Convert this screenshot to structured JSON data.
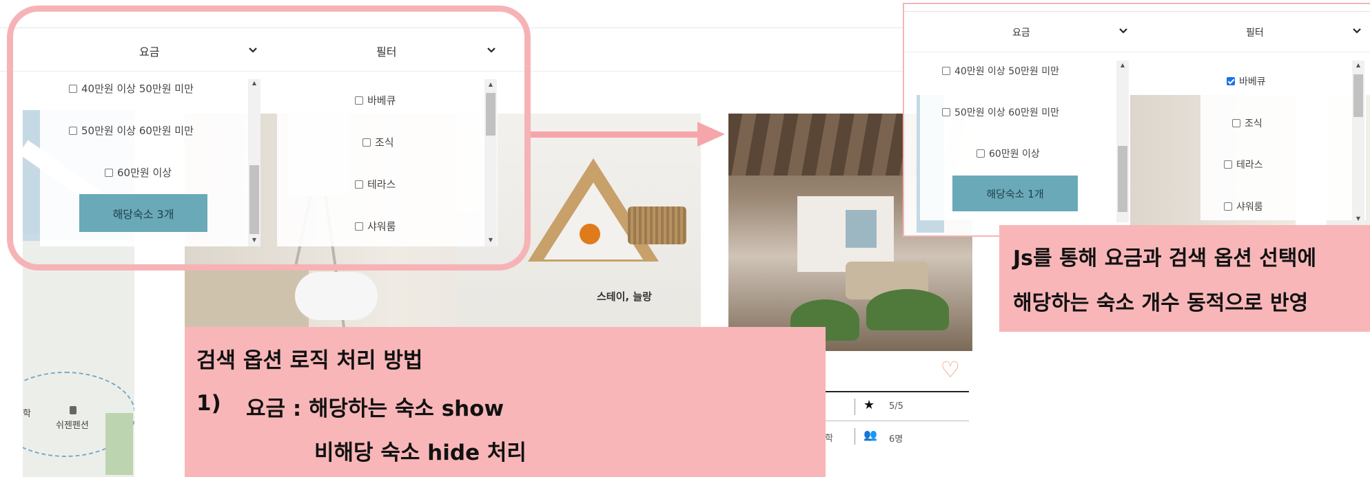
{
  "left_panel": {
    "price_label": "요금",
    "filter_label": "필터",
    "price_options": [
      "40만원 이상 50만원 미만",
      "50만원 이상 60만원 미만",
      "60만원 이상"
    ],
    "filter_options": [
      {
        "label": "바베큐",
        "checked": false
      },
      {
        "label": "조식",
        "checked": false
      },
      {
        "label": "테라스",
        "checked": false
      },
      {
        "label": "샤워룸",
        "checked": false
      }
    ],
    "count_button": "해당숙소 3개"
  },
  "right_panel": {
    "price_label": "요금",
    "filter_label": "필터",
    "price_options": [
      "40만원 이상 50만원 미만",
      "50만원 이상 60만원 미만",
      "60만원 이상"
    ],
    "filter_options": [
      {
        "label": "바베큐",
        "checked": true
      },
      {
        "label": "조식",
        "checked": false
      },
      {
        "label": "테라스",
        "checked": false
      },
      {
        "label": "샤워룸",
        "checked": false
      }
    ],
    "count_button": "해당숙소 1개"
  },
  "map": {
    "place_label": "쉬젠펜션",
    "partial_label": "학"
  },
  "photo_caption": "스테이, 늘랑",
  "card": {
    "rating": "5/5",
    "capacity": "6명",
    "partial_left": "학"
  },
  "callout_right": {
    "line1": "Js를 통해 요금과 검색 옵션 선택에",
    "line2": "해당하는 숙소 개수 동적으로 반영"
  },
  "callout_bottom": {
    "title": "검색 옵션 로직 처리 방법",
    "item_number": "1)",
    "item_text": "요금 : 해당하는 숙소 show",
    "item_sub": "비해당 숙소 hide 처리"
  },
  "colors": {
    "accent_pink": "#f6b3b6",
    "count_button": "#6aa9b8",
    "checkbox_on": "#1a73e8"
  },
  "icons": [
    "chevron-down-icon",
    "checkbox-icon",
    "heart-icon",
    "star-icon",
    "people-icon"
  ]
}
